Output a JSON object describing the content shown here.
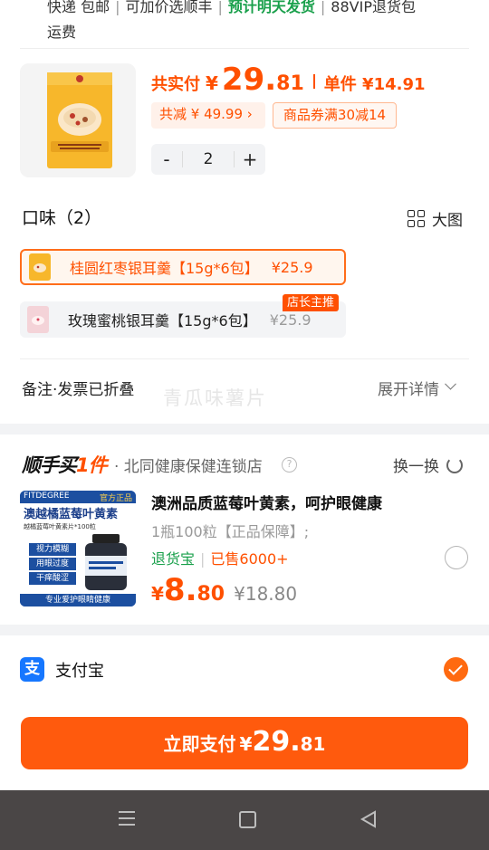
{
  "shipping": {
    "line1_a": "快递 包邮",
    "line1_b": "可加价选顺丰",
    "line1_c": "预计明天发货",
    "line1_d": "88VIP退货包",
    "line2": "运费"
  },
  "product": {
    "image_alt": "桂圆红枣银耳羹",
    "total_label": "共实付",
    "currency": "¥",
    "total_int": "29.",
    "total_dec": "81",
    "unit_label": "单件 ¥14.91",
    "saved_label": "共减 ¥ 49.99 ›",
    "coupon_label": "商品券满30减14",
    "quantity": "2",
    "minus": "-",
    "plus": "+"
  },
  "flavor": {
    "title": "口味（2）",
    "big_view": "大图",
    "options": [
      {
        "name": "桂圆红枣银耳羹【15g*6包】",
        "price": "¥25.9",
        "selected": true
      },
      {
        "name": "玫瑰蜜桃银耳羹【15g*6包】",
        "price": "¥25.9",
        "selected": false,
        "badge": "店长主推"
      }
    ]
  },
  "remark": {
    "label": "备注·发票已折叠",
    "watermark": "青瓜味薯片",
    "expand": "展开详情"
  },
  "recommend": {
    "brand_a": "顺手买",
    "brand_b": "1件",
    "shop": "· 北同健康保健连锁店",
    "help": "?",
    "swap": "换一换",
    "img_brand": "FITDEGREE",
    "img_badge": "官方正品",
    "img_title": "澳越橘蓝莓叶黄素",
    "img_line": "越橘蓝莓叶黄素片*100粒",
    "img_tags": [
      "视力模糊",
      "用眼过度",
      "干痒酸涩"
    ],
    "img_footer": "专业爱护眼睛健康",
    "title": "澳洲品质蓝莓叶黄素，呵护眼健康",
    "spec": "1瓶100粒【正品保障】;",
    "returns": "退货宝",
    "sold": "已售6000+",
    "currency": "¥",
    "price_int": "8.",
    "price_dec": "80",
    "orig_price": "¥18.80"
  },
  "payment": {
    "icon_char": "支",
    "method": "支付宝",
    "button_label": "立即支付",
    "currency": "¥",
    "amount_int": "29.",
    "amount_dec": "81"
  },
  "colors": {
    "accent": "#ff5000",
    "green": "#19a04b",
    "alipay": "#1677ff"
  }
}
